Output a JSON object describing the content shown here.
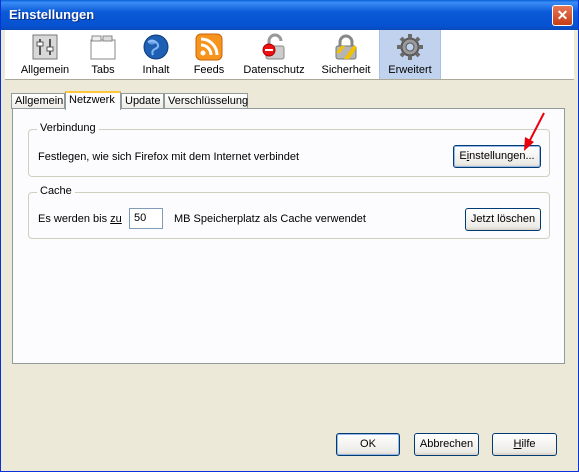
{
  "window": {
    "title": "Einstellungen",
    "close_glyph": "✕"
  },
  "toolbar": {
    "items": [
      {
        "label": "Allgemein",
        "icon": "general-icon"
      },
      {
        "label": "Tabs",
        "icon": "tabs-icon"
      },
      {
        "label": "Inhalt",
        "icon": "content-globe-icon"
      },
      {
        "label": "Feeds",
        "icon": "rss-icon"
      },
      {
        "label": "Datenschutz",
        "icon": "privacy-lock-icon"
      },
      {
        "label": "Sicherheit",
        "icon": "security-padlock-icon"
      },
      {
        "label": "Erweitert",
        "icon": "gear-icon",
        "selected": true
      }
    ]
  },
  "subtabs": [
    {
      "label": "Allgemein"
    },
    {
      "label": "Netzwerk",
      "active": true
    },
    {
      "label": "Update"
    },
    {
      "label": "Verschlüsselung"
    }
  ],
  "connection": {
    "legend": "Verbindung",
    "description": "Festlegen, wie sich Firefox mit dem Internet verbindet",
    "settings_button": {
      "before": "E",
      "mnemonic": "i",
      "after": "nstellungen..."
    }
  },
  "cache": {
    "legend": "Cache",
    "label_before": "Es werden bis ",
    "label_mnemonic": "zu",
    "value": "50",
    "label_after": "MB Speicherplatz als Cache verwendet",
    "clear_button": "Jetzt löschen"
  },
  "footer": {
    "ok": "OK",
    "cancel": "Abbrechen",
    "help_mnemonic": "H",
    "help_rest": "ilfe"
  },
  "colors": {
    "titlebar": "#0b5bd9",
    "selected_toolbar": "#c1d2ee",
    "annotation_arrow": "#e8000b"
  }
}
